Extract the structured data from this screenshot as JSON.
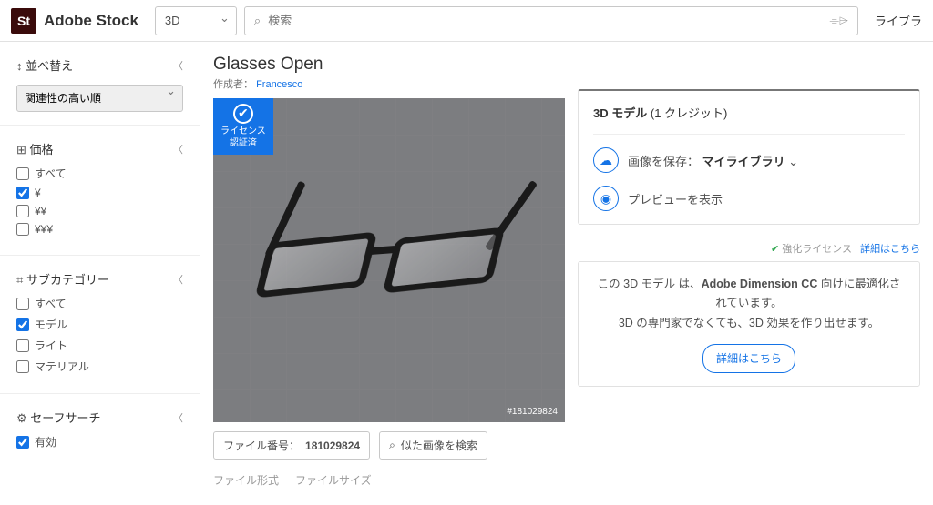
{
  "header": {
    "logo_initials": "St",
    "brand": "Adobe Stock",
    "category_selected": "3D",
    "search_placeholder": "検索",
    "nav_library": "ライブラ"
  },
  "sidebar": {
    "sort": {
      "icon": "↕",
      "label": "並べ替え",
      "selected": "関連性の高い順"
    },
    "price": {
      "icon": "⊞",
      "label": "価格",
      "options": [
        {
          "label": "すべて",
          "checked": false
        },
        {
          "label": "¥",
          "checked": true
        },
        {
          "label": "¥¥",
          "checked": false
        },
        {
          "label": "¥¥¥",
          "checked": false
        }
      ]
    },
    "subcategory": {
      "icon": "⌗",
      "label": "サブカテゴリー",
      "options": [
        {
          "label": "すべて",
          "checked": false
        },
        {
          "label": "モデル",
          "checked": true
        },
        {
          "label": "ライト",
          "checked": false
        },
        {
          "label": "マテリアル",
          "checked": false
        }
      ]
    },
    "safesearch": {
      "icon": "⚙",
      "label": "セーフサーチ",
      "option_label": "有効",
      "checked": true
    }
  },
  "asset": {
    "title": "Glasses Open",
    "byline_prefix": "作成者：",
    "author": "Francesco",
    "license_badge": "ライセンス\n認証済",
    "overlay_id": "#181029824",
    "file_no_label": "ファイル番号：",
    "file_no": "181029824",
    "similar_btn": "似た画像を検索",
    "meta_format": "ファイル形式",
    "meta_size": "ファイルサイズ"
  },
  "purchase": {
    "sku_label": "3D モデル",
    "sku_credits": "(1 クレジット)",
    "save_label": "画像を保存：",
    "save_target": "マイライブラリ",
    "preview_label": "プレビューを表示",
    "enhanced_label": "強化ライセンス",
    "enhanced_link": "詳細はこちら"
  },
  "promo": {
    "line1a": "この 3D モデル は、",
    "line1b": "Adobe Dimension CC",
    "line1c": " 向けに最適化されています。",
    "line2": "3D の専門家でなくても、3D 効果を作り出せます。",
    "cta": "詳細はこちら"
  }
}
